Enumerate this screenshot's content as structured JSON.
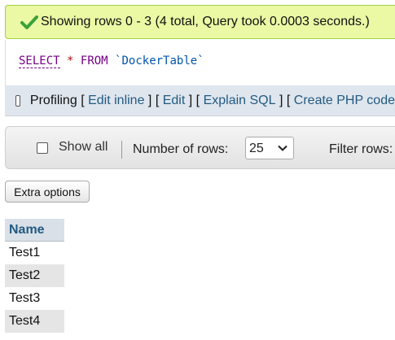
{
  "success": {
    "icon": "check-icon",
    "message": "Showing rows 0 - 3 (4 total, Query took 0.0003 seconds.)"
  },
  "sql": {
    "select": "SELECT",
    "star": "*",
    "from": "FROM",
    "table": "`DockerTable`"
  },
  "profiling": {
    "label": "Profiling",
    "open": "[",
    "close": "]",
    "links": [
      "Edit inline",
      "Edit",
      "Explain SQL",
      "Create PHP code"
    ]
  },
  "navigation": {
    "show_all": "Show all",
    "number_of_rows_label": "Number of rows:",
    "rows_selected": "25",
    "filter_label": "Filter rows:"
  },
  "extra_options": "Extra options",
  "table": {
    "columns": [
      "Name"
    ],
    "rows": [
      "Test1",
      "Test2",
      "Test3",
      "Test4"
    ]
  },
  "colors": {
    "success_bg": "#ebf8a4",
    "link": "#235a81",
    "sql_keyword": "#770088",
    "sql_table": "#0055aa"
  }
}
